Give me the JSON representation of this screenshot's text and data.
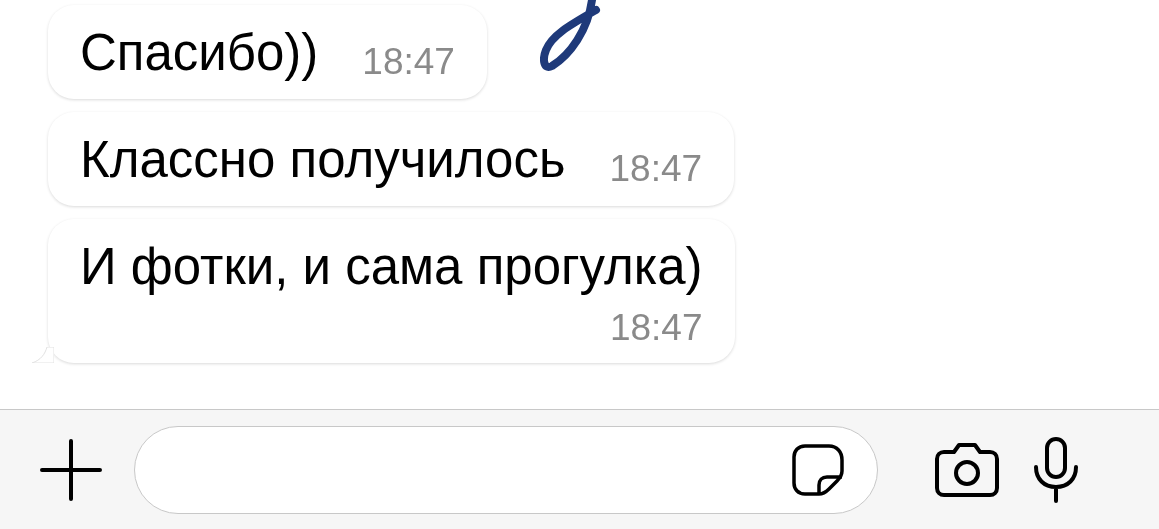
{
  "messages": [
    {
      "text": "Спасибо))",
      "time": "18:47",
      "time_below": false,
      "tail": false
    },
    {
      "text": "Классно получилось",
      "time": "18:47",
      "time_below": false,
      "tail": false
    },
    {
      "text": "И фотки, и сама прогулка)",
      "time": "18:47",
      "time_below": true,
      "tail": true
    }
  ]
}
